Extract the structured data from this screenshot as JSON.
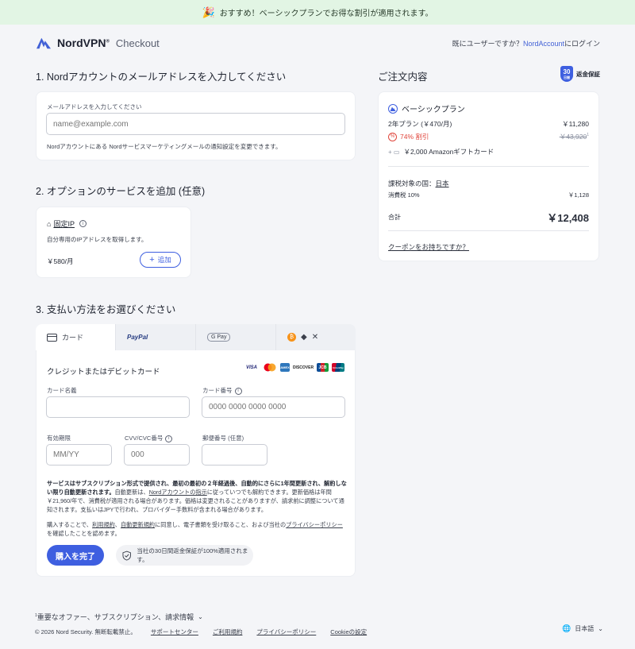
{
  "banner": {
    "text": "おすすめ！ベーシックプランでお得な割引が適用されます。"
  },
  "header": {
    "brand": "NordVPN",
    "brand_mark": "®",
    "sub": "Checkout",
    "login_prefix": "既にユーザーですか？",
    "login_link": "NordAccount",
    "login_suffix": "にログイン"
  },
  "email_section": {
    "title": "1. Nordアカウントのメールアドレスを入力してください",
    "label": "メールアドレスを入力してください",
    "placeholder": "name@example.com",
    "note": "Nordアカウントにある Nordサービスマーケティングメールの通知設定を変更できます。"
  },
  "options_section": {
    "title": "2. オプションのサービスを追加 (任意)",
    "item_name": "固定IP",
    "item_desc": "自分専用のIPアドレスを取得します。",
    "item_price": "￥580/月",
    "add_label": "追加"
  },
  "payment_section": {
    "title": "3. 支払い方法をお選びください",
    "tabs": {
      "card": "カード",
      "paypal": "PayPal",
      "gpay": "G Pay"
    },
    "card_heading": "クレジットまたはデビットカード",
    "card_brands": [
      "VISA",
      "mastercard",
      "AMEX",
      "DISCOVER",
      "JCB",
      "UnionPay"
    ],
    "card_name_label": "カード名義",
    "card_number_label": "カード番号",
    "card_number_placeholder": "0000 0000 0000 0000",
    "expiry_label": "有効期限",
    "expiry_placeholder": "MM/YY",
    "cvv_label": "CVV/CVC番号",
    "cvv_placeholder": "000",
    "postal_label": "郵便番号 (任意)",
    "terms_bold": "サービスはサブスクリプション形式で提供され、最初の最初の２年経過後、自動的にさらに1年間更新され、解約しない限り自動更新されます。",
    "terms_text_1": "自動更新は、",
    "terms_link_1": "Nordアカウントの指示",
    "terms_text_2": "に従っていつでも解約できます。更新価格は年間￥21,960/年で、消費税が適用される場合があります。価格は変更されることがありますが、請求前に調整について通知されます。支払いはJPYで行われ、プロバイダー手数料が含まれる場合があります。",
    "terms_text_3": "購入することで、",
    "terms_link_2": "利用規約",
    "terms_text_4": "、",
    "terms_link_3": "自動更新規約",
    "terms_text_5": "に同意し、電子書類を受け取ること、および当社の",
    "terms_link_4": "プライバシーポリシー",
    "terms_text_6": "を確認したことを認めます。",
    "submit_label": "購入を完了",
    "guarantee_text": "当社の30日間返金保証が100%適用されます。"
  },
  "summary": {
    "title": "ご注文内容",
    "badge_number": "30",
    "badge_sub": "日間",
    "guarantee_label": "返金保証",
    "plan_name": "ベーシックプラン",
    "term_label": "2年プラン (￥470/月)",
    "term_price": "￥11,280",
    "discount_label": "74% 割引",
    "discount_price": "￥43,920",
    "discount_sup": "1",
    "gift_label": "￥2,000 Amazonギフトカード",
    "country_label": "課税対象の国：",
    "country_value": "日本",
    "tax_label": "消費税 10%",
    "tax_value": "￥1,128",
    "total_label": "合計",
    "total_value": "￥12,408",
    "coupon_link": "クーポンをお持ちですか？"
  },
  "footer": {
    "sup": "1",
    "offers": "重要なオファー、サブスクリプション、請求情報",
    "copyright": "© 2026 Nord Security. 無断転載禁止。",
    "support": "サポートセンター",
    "terms": "ご利用規約",
    "privacy": "プライバシーポリシー",
    "cookies": "Cookieの設定",
    "language": "日本語"
  },
  "colors": {
    "accent": "#3e5fe0",
    "banner_bg": "#e2f5e4",
    "discount_red": "#e0463c"
  }
}
